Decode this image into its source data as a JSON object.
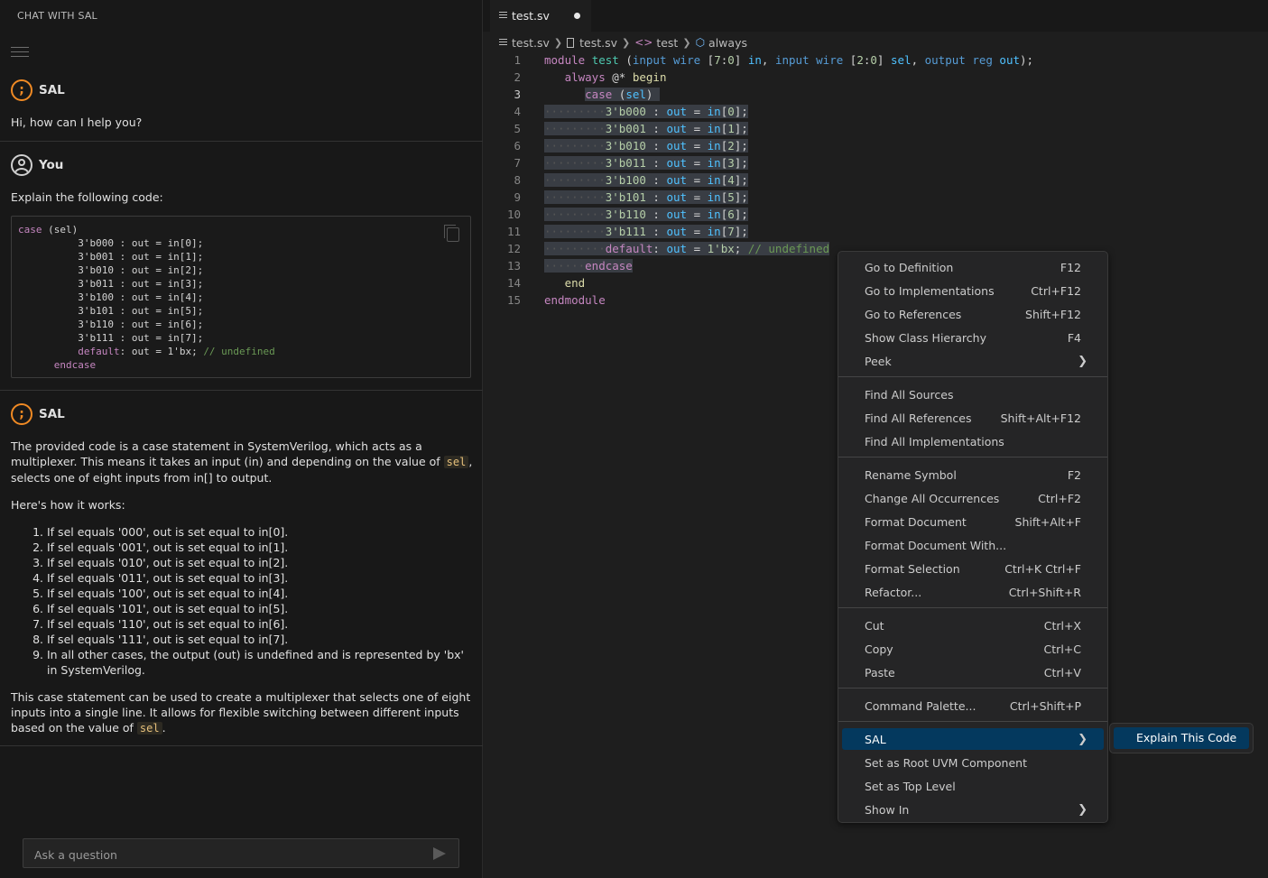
{
  "chat": {
    "header": "CHAT WITH SAL",
    "greeting": {
      "name": "SAL",
      "text": "Hi, how can I help you?"
    },
    "user": {
      "name": "You",
      "text": "Explain the following code:",
      "code": "case (sel)\n          3'b000 : out = in[0];\n          3'b001 : out = in[1];\n          3'b010 : out = in[2];\n          3'b011 : out = in[3];\n          3'b100 : out = in[4];\n          3'b101 : out = in[5];\n          3'b110 : out = in[6];\n          3'b111 : out = in[7];\n          default: out = 1'bx; // undefined\n      endcase"
    },
    "answer": {
      "name": "SAL",
      "p1_before": "The provided code is a case statement in SystemVerilog, which acts as a multiplexer. This means it takes an input (in) and depending on the value of ",
      "p1_code": "sel",
      "p1_after": ", selects one of eight inputs from in[] to output.",
      "p2": "Here's how it works:",
      "list": [
        "If sel equals '000', out is set equal to in[0].",
        "If sel equals '001', out is set equal to in[1].",
        "If sel equals '010', out is set equal to in[2].",
        "If sel equals '011', out is set equal to in[3].",
        "If sel equals '100', out is set equal to in[4].",
        "If sel equals '101', out is set equal to in[5].",
        "If sel equals '110', out is set equal to in[6].",
        "If sel equals '111', out is set equal to in[7].",
        "In all other cases, the output (out) is undefined and is represented by 'bx' in SystemVerilog."
      ],
      "p3_before": "This case statement can be used to create a multiplexer that selects one of eight inputs into a single line. It allows for flexible switching between different inputs based on the value of ",
      "p3_code": "sel",
      "p3_after": "."
    },
    "input_placeholder": "Ask a question"
  },
  "editor": {
    "tab_label": "test.sv",
    "breadcrumb": [
      "test.sv",
      "test.sv",
      "test",
      "always"
    ],
    "line_numbers": [
      "1",
      "2",
      "3",
      "4",
      "5",
      "6",
      "7",
      "8",
      "9",
      "10",
      "11",
      "12",
      "13",
      "14",
      "15"
    ]
  },
  "context_menu": {
    "items": [
      {
        "label": "Go to Definition",
        "key": "F12"
      },
      {
        "label": "Go to Implementations",
        "key": "Ctrl+F12"
      },
      {
        "label": "Go to References",
        "key": "Shift+F12"
      },
      {
        "label": "Show Class Hierarchy",
        "key": "F4"
      },
      {
        "label": "Peek",
        "key": ""
      },
      {
        "label": "Find All Sources",
        "key": ""
      },
      {
        "label": "Find All References",
        "key": "Shift+Alt+F12"
      },
      {
        "label": "Find All Implementations",
        "key": ""
      },
      {
        "label": "Rename Symbol",
        "key": "F2"
      },
      {
        "label": "Change All Occurrences",
        "key": "Ctrl+F2"
      },
      {
        "label": "Format Document",
        "key": "Shift+Alt+F"
      },
      {
        "label": "Format Document With...",
        "key": ""
      },
      {
        "label": "Format Selection",
        "key": "Ctrl+K Ctrl+F"
      },
      {
        "label": "Refactor...",
        "key": "Ctrl+Shift+R"
      },
      {
        "label": "Cut",
        "key": "Ctrl+X"
      },
      {
        "label": "Copy",
        "key": "Ctrl+C"
      },
      {
        "label": "Paste",
        "key": "Ctrl+V"
      },
      {
        "label": "Command Palette...",
        "key": "Ctrl+Shift+P"
      },
      {
        "label": "SAL",
        "key": ""
      },
      {
        "label": "Set as Root UVM Component",
        "key": ""
      },
      {
        "label": "Set as Top Level",
        "key": ""
      },
      {
        "label": "Show In",
        "key": ""
      }
    ],
    "submenu_item": "Explain This Code"
  }
}
